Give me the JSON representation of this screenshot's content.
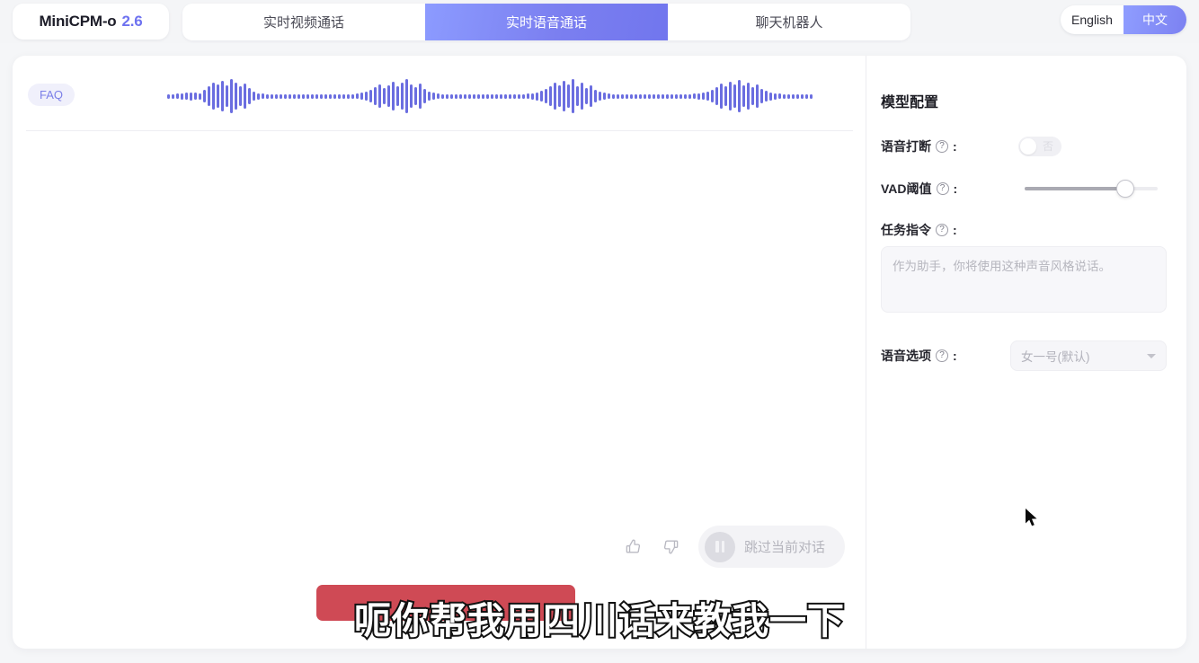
{
  "header": {
    "brand_name": "MiniCPM-o",
    "brand_version": "2.6",
    "tabs": [
      {
        "label": "实时视频通话",
        "active": false
      },
      {
        "label": "实时语音通话",
        "active": true
      },
      {
        "label": "聊天机器人",
        "active": false
      }
    ],
    "language": [
      {
        "label": "English",
        "active": false
      },
      {
        "label": "中文",
        "active": true
      }
    ]
  },
  "main": {
    "faq_label": "FAQ",
    "waveform": {
      "bar_color": "#6a6de0",
      "heights": [
        5,
        5,
        6,
        7,
        8,
        9,
        8,
        7,
        14,
        22,
        30,
        26,
        34,
        24,
        38,
        30,
        22,
        28,
        18,
        10,
        7,
        6,
        5,
        5,
        5,
        5,
        5,
        5,
        5,
        5,
        5,
        5,
        5,
        5,
        5,
        5,
        5,
        5,
        5,
        5,
        5,
        5,
        6,
        8,
        10,
        14,
        20,
        26,
        18,
        24,
        32,
        22,
        30,
        38,
        26,
        20,
        28,
        16,
        10,
        8,
        6,
        5,
        5,
        5,
        5,
        5,
        5,
        5,
        5,
        5,
        5,
        5,
        5,
        5,
        5,
        5,
        5,
        5,
        5,
        5,
        6,
        7,
        9,
        12,
        16,
        22,
        30,
        24,
        34,
        26,
        38,
        22,
        30,
        18,
        24,
        14,
        10,
        8,
        6,
        5,
        5,
        5,
        5,
        5,
        5,
        5,
        5,
        5,
        5,
        5,
        5,
        5,
        5,
        5,
        5,
        5,
        5,
        6,
        7,
        8,
        10,
        14,
        20,
        28,
        22,
        32,
        26,
        36,
        24,
        30,
        20,
        26,
        16,
        12,
        9,
        7,
        6,
        5,
        5,
        5,
        5,
        5,
        5,
        5
      ]
    },
    "controls": {
      "thumbs_up": "thumbs-up-icon",
      "thumbs_down": "thumbs-down-icon",
      "skip_label": "跳过当前对话"
    },
    "subtitle": {
      "text": "呃你帮我用四川话来教我一下",
      "highlight_color": "#cf4a55"
    }
  },
  "config": {
    "title": "模型配置",
    "interrupt": {
      "label": "语音打断",
      "help": "?",
      "colon": ":",
      "toggle_value": "否",
      "enabled": false
    },
    "vad": {
      "label": "VAD阈值",
      "help": "?",
      "colon": ":",
      "value_percent": 76
    },
    "task": {
      "label": "任务指令",
      "help": "?",
      "colon": ":",
      "value": "",
      "placeholder": "作为助手，你将使用这种声音风格说话。"
    },
    "voice": {
      "label": "语音选项",
      "help": "?",
      "colon": ":",
      "selected": "女一号(默认)"
    }
  }
}
